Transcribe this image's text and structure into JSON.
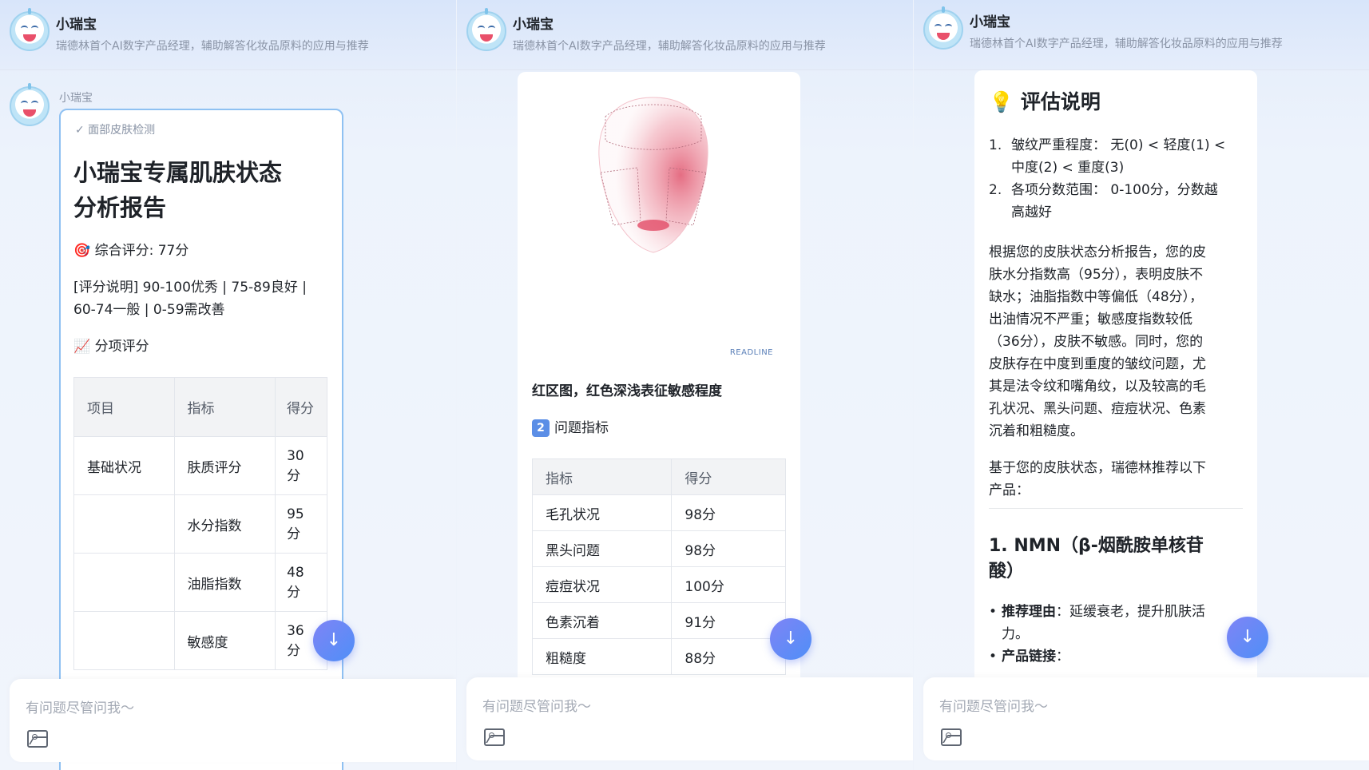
{
  "header": {
    "name": "小瑞宝",
    "desc": "瑞德林首个AI数字产品经理，辅助解答化妆品原料的应用与推荐"
  },
  "input": {
    "placeholder": "有问题尽管问我～"
  },
  "panel1": {
    "sender": "小瑞宝",
    "chip": "✓ 面部皮肤检测",
    "title_line1": "小瑞宝专属肌肤状态",
    "title_line2": "分析报告",
    "score_line": "综合评分: 77分",
    "desc_line1": "[评分说明] 90-100优秀 | 75-89良好 |",
    "desc_line2": "60-74一般 | 0-59需改善",
    "sub_heading": "分项评分",
    "table": {
      "headers": [
        "项目",
        "指标",
        "得分"
      ],
      "rows": [
        [
          "基础状况",
          "肤质评分",
          "30分"
        ],
        [
          "",
          "水分指数",
          "95分"
        ],
        [
          "",
          "油脂指数",
          "48分"
        ],
        [
          "",
          "敏感度",
          "36分"
        ]
      ]
    }
  },
  "panel2": {
    "watermark": "READLINE",
    "caption": "红区图，红色深浅表征敏感程度",
    "section_num": "2",
    "section_label": "问题指标",
    "table": {
      "headers": [
        "指标",
        "得分"
      ],
      "rows": [
        [
          "毛孔状况",
          "98分"
        ],
        [
          "黑头问题",
          "98分"
        ],
        [
          "痘痘状况",
          "100分"
        ],
        [
          "色素沉着",
          "91分"
        ],
        [
          "粗糙度",
          "88分"
        ]
      ]
    }
  },
  "panel3": {
    "heading": "评估说明",
    "list": [
      {
        "n": "1.",
        "l1": "皱纹严重程度： 无(0) < 轻度(1) <",
        "l2": "中度(2) < 重度(3)"
      },
      {
        "n": "2.",
        "l1": "各项分数范围： 0-100分，分数越",
        "l2": "高越好"
      }
    ],
    "para1": [
      "根据您的皮肤状态分析报告，您的皮",
      "肤水分指数高（95分），表明皮肤不",
      "缺水；油脂指数中等偏低（48分），",
      "出油情况不严重；敏感度指数较低",
      "（36分），皮肤不敏感。同时，您的",
      "皮肤存在中度到重度的皱纹问题，尤",
      "其是法令纹和嘴角纹，以及较高的毛",
      "孔状况、黑头问题、痘痘状况、色素",
      "沉着和粗糙度。"
    ],
    "para2": [
      "基于您的皮肤状态，瑞德林推荐以下",
      "产品："
    ],
    "product_title_l1": "1. NMN（β-烟酰胺单核苷",
    "product_title_l2": "酸）",
    "bullet1_label": "推荐理由",
    "bullet1_text": "：延缓衰老，提升肌肤活",
    "bullet1_text2": "力。",
    "bullet2_label": "产品链接",
    "bullet2_text": "："
  },
  "colors": {
    "accent": "#4f8ff7",
    "card_border": "#8fc1f2"
  }
}
